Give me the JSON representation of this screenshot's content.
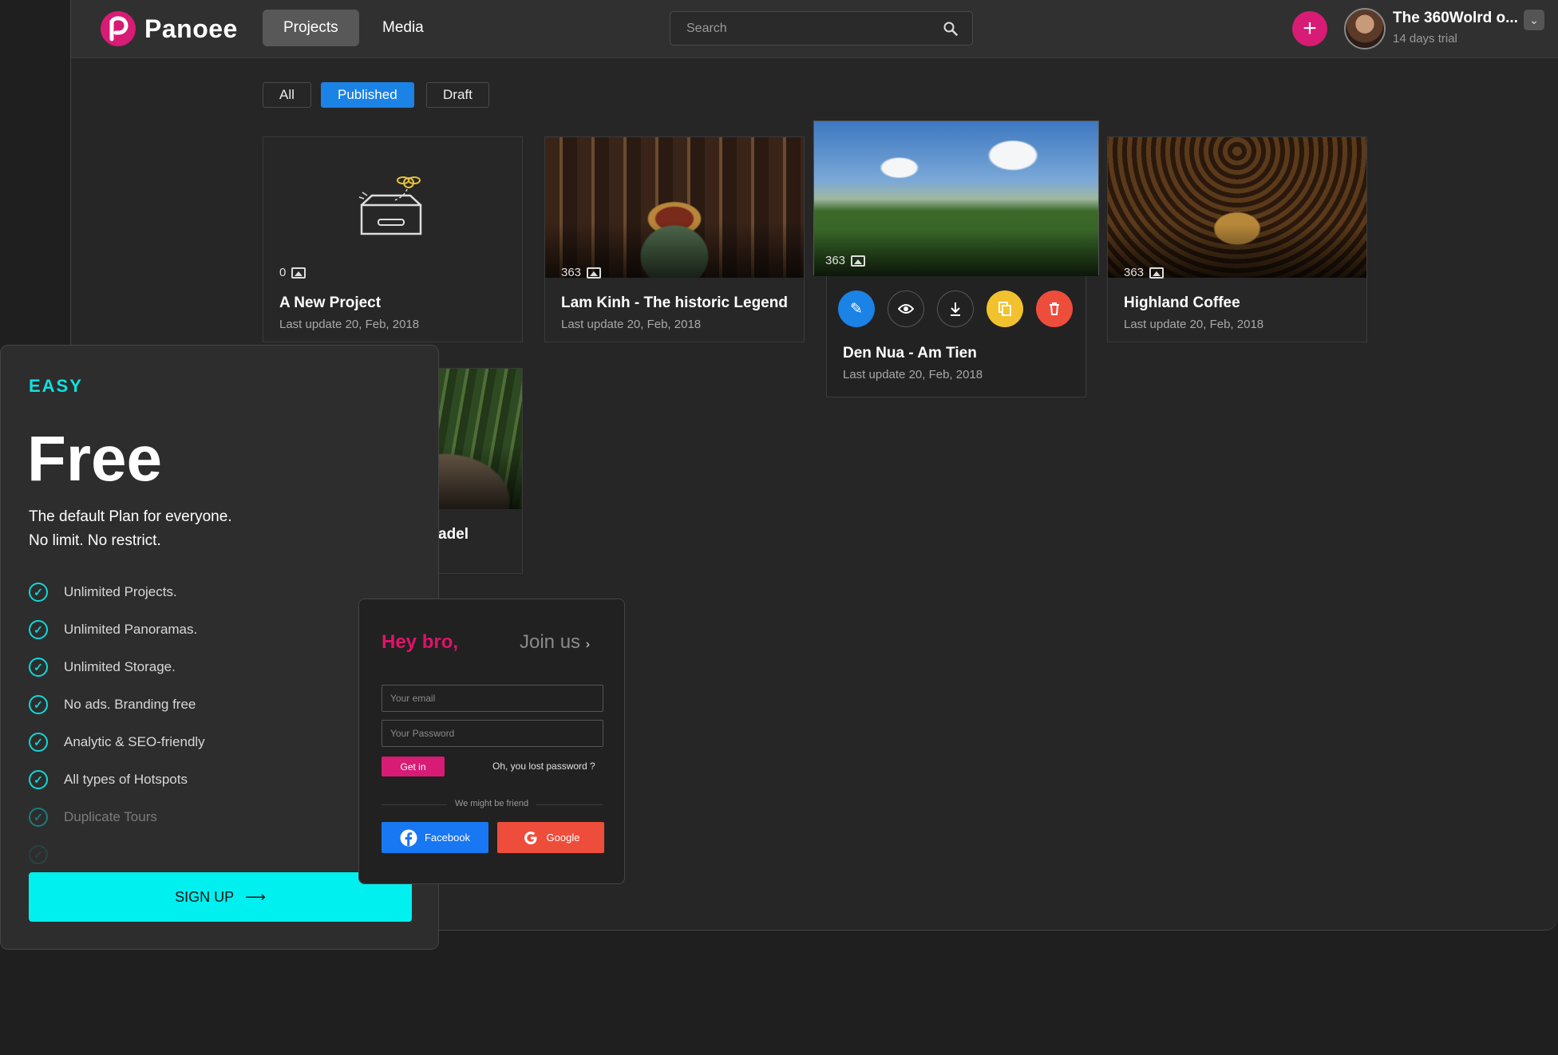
{
  "header": {
    "logo_text": "Panoee",
    "nav": [
      "Projects",
      "Media"
    ],
    "search_placeholder": "Search",
    "user_name": "The 360Wolrd o...",
    "user_sub": "14 days trial",
    "brand_color": "#d81b74"
  },
  "filters": [
    "All",
    "Published",
    "Draft"
  ],
  "projects": [
    {
      "title": "A New Project",
      "date": "Last update 20, Feb, 2018",
      "count": "0"
    },
    {
      "title": "Lam Kinh - The historic Legend",
      "date": "Last update 20, Feb, 2018",
      "count": "363"
    },
    {
      "title": "Den Nua - Am Tien",
      "date": "Last update 20, Feb, 2018",
      "count": "363"
    },
    {
      "title": "Highland Coffee",
      "date": "Last update 20, Feb, 2018",
      "count": "363"
    },
    {
      "title_partial": "adel"
    }
  ],
  "plan": {
    "tag": "EASY",
    "name": "Free",
    "desc_line1": "The default Plan for everyone.",
    "desc_line2": "No limit. No restrict.",
    "features": [
      "Unlimited Projects.",
      "Unlimited Panoramas.",
      "Unlimited Storage.",
      "No ads. Branding free",
      "Analytic & SEO-friendly",
      "All types of Hotspots",
      "Duplicate Tours"
    ],
    "signup_label": "SIGN UP",
    "accent_color": "#00f0f0"
  },
  "login": {
    "greeting": "Hey bro,",
    "join": "Join us",
    "email_placeholder": "Your email",
    "password_placeholder": "Your Password",
    "submit": "Get in",
    "lost": "Oh, you lost password ?",
    "divider": "We might be friend",
    "facebook": "Facebook",
    "google": "Google"
  }
}
